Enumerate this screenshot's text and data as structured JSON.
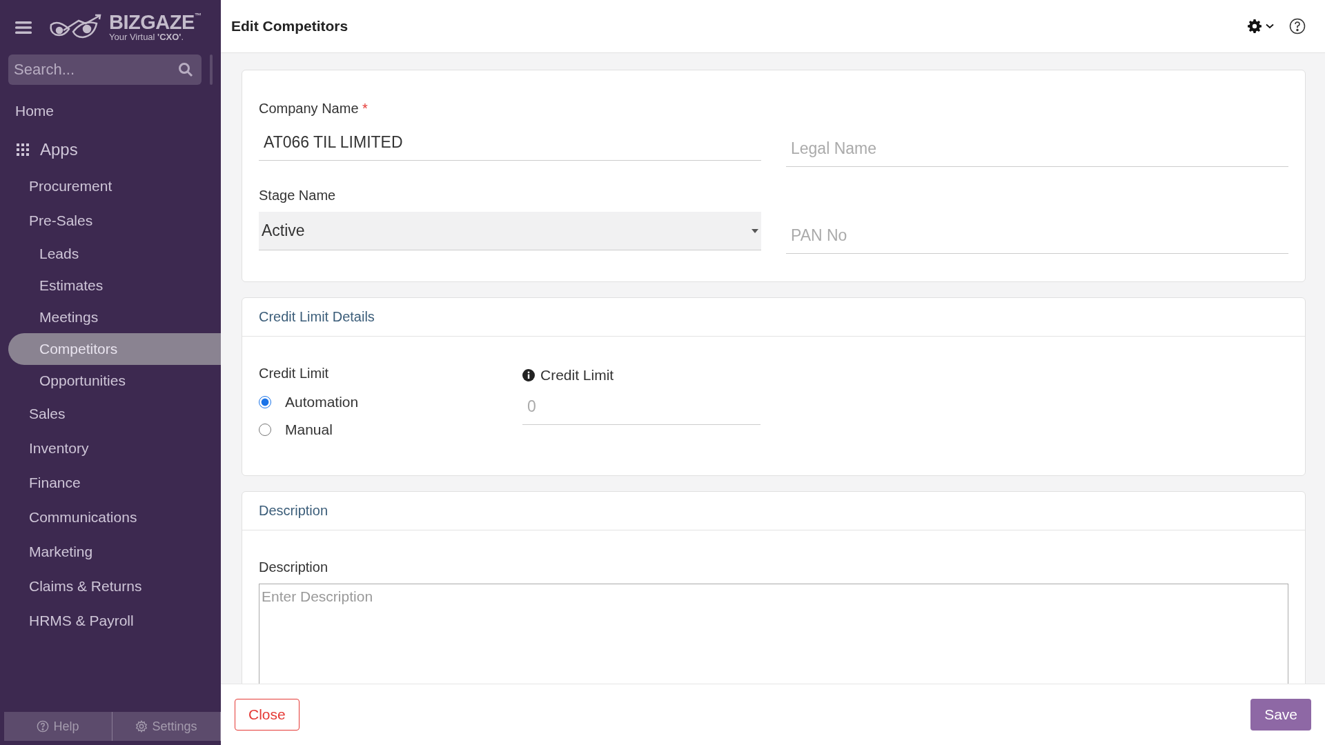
{
  "sidebar": {
    "logo": {
      "name": "BIZGAZE",
      "trademark": "™",
      "tagline": "Your Virtual **'CXO'**."
    },
    "search": {
      "placeholder": "Search..."
    },
    "home": "Home",
    "apps": {
      "label": "Apps",
      "items": [
        {
          "label": "Procurement",
          "selected": false
        },
        {
          "label": "Pre-Sales",
          "selected": false,
          "children": [
            {
              "label": "Leads",
              "selected": false
            },
            {
              "label": "Estimates",
              "selected": false
            },
            {
              "label": "Meetings",
              "selected": false
            },
            {
              "label": "Competitors",
              "selected": true
            },
            {
              "label": "Opportunities",
              "selected": false
            }
          ]
        },
        {
          "label": "Sales",
          "selected": false
        },
        {
          "label": "Inventory",
          "selected": false
        },
        {
          "label": "Finance",
          "selected": false
        },
        {
          "label": "Communications",
          "selected": false
        },
        {
          "label": "Marketing",
          "selected": false
        },
        {
          "label": "Claims & Returns",
          "selected": false
        },
        {
          "label": "HRMS & Payroll",
          "selected": false
        }
      ]
    },
    "footer": [
      {
        "kind": "help",
        "label": "Help"
      },
      {
        "kind": "settings",
        "label": "Settings"
      }
    ]
  },
  "page": {
    "title": "Edit Competitors"
  },
  "main_form": {
    "company_name": {
      "label": "Company Name",
      "required_mark": "*",
      "value": "AT066 TIL LIMITED"
    },
    "legal_name": {
      "placeholder": "Legal Name"
    },
    "stage_name": {
      "label": "Stage Name",
      "value": "Active"
    },
    "pan_no": {
      "placeholder": "PAN No"
    }
  },
  "credit": {
    "title": "Credit Limit Details",
    "label": "Credit Limit",
    "options": [
      {
        "label": "Automation",
        "selected": true
      },
      {
        "label": "Manual",
        "selected": false
      }
    ],
    "amount": {
      "label": "Credit Limit",
      "placeholder": "0"
    }
  },
  "description": {
    "title": "Description",
    "label": "Description",
    "placeholder": "Enter Description"
  },
  "actions": {
    "close": "Close",
    "save": "Save"
  }
}
